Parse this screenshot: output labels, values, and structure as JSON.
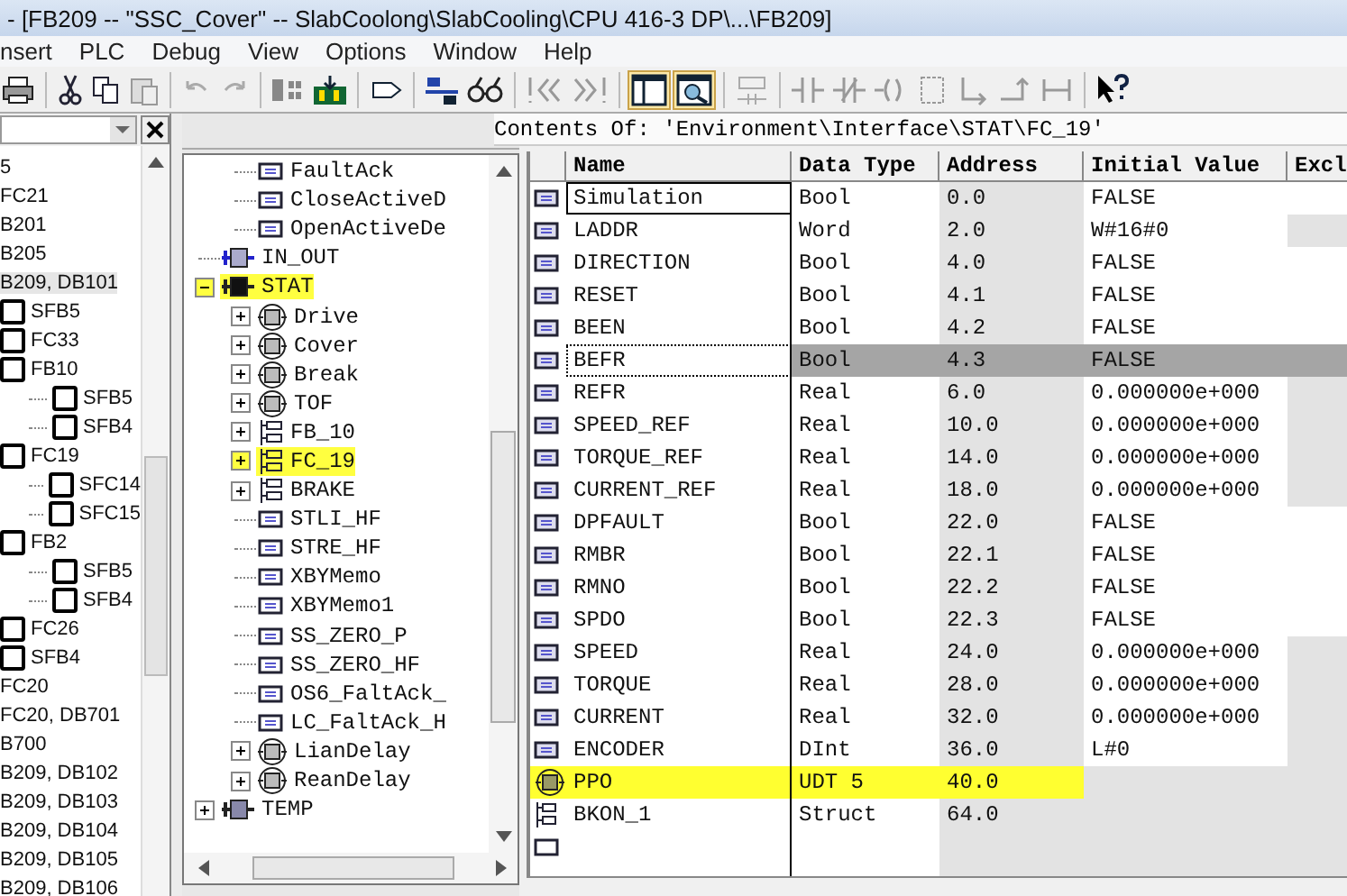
{
  "window": {
    "title": "- [FB209 -- \"SSC_Cover\" -- SlabCoolong\\SlabCooling\\CPU 416-3 DP\\...\\FB209]"
  },
  "menu": [
    "nsert",
    "PLC",
    "Debug",
    "View",
    "Options",
    "Window",
    "Help"
  ],
  "block_list": {
    "items": [
      {
        "label": "5"
      },
      {
        "label": "FC21"
      },
      {
        "label": "B201"
      },
      {
        "label": "B205"
      },
      {
        "label": "B209, DB101",
        "selected": true,
        "children": [
          {
            "label": "SFB5"
          },
          {
            "label": "FC33"
          },
          {
            "label": "FB10",
            "children": [
              {
                "label": "SFB5"
              },
              {
                "label": "SFB4"
              }
            ]
          },
          {
            "label": "FC19",
            "children": [
              {
                "label": "SFC14"
              },
              {
                "label": "SFC15"
              }
            ]
          },
          {
            "label": "FB2",
            "children": [
              {
                "label": "SFB5"
              },
              {
                "label": "SFB4"
              }
            ]
          },
          {
            "label": "FC26"
          },
          {
            "label": "SFB4"
          }
        ]
      },
      {
        "label": "FC20"
      },
      {
        "label": "FC20, DB701"
      },
      {
        "label": "B700"
      },
      {
        "label": "B209, DB102"
      },
      {
        "label": "B209, DB103"
      },
      {
        "label": "B209, DB104"
      },
      {
        "label": "B209, DB105"
      },
      {
        "label": "B209, DB106"
      }
    ]
  },
  "tree": {
    "continued_children": [
      {
        "label": "FaultAck",
        "kind": "param"
      },
      {
        "label": "CloseActiveD",
        "kind": "param"
      },
      {
        "label": "OpenActiveDe",
        "kind": "param"
      }
    ],
    "items": [
      {
        "label": "IN_OUT",
        "kind": "inout",
        "highlighted": false
      },
      {
        "label": "STAT",
        "kind": "stat",
        "expanded": true,
        "highlighted": true,
        "children": [
          {
            "label": "Drive",
            "kind": "instance",
            "expanded": false,
            "highlighted": false
          },
          {
            "label": "Cover",
            "kind": "instance",
            "expanded": false,
            "highlighted": false
          },
          {
            "label": "Break",
            "kind": "instance",
            "expanded": false,
            "highlighted": false
          },
          {
            "label": "TOF",
            "kind": "instance",
            "expanded": false,
            "highlighted": false
          },
          {
            "label": "FB_10",
            "kind": "struct",
            "expanded": false,
            "highlighted": false
          },
          {
            "label": "FC_19",
            "kind": "struct",
            "expanded": false,
            "highlighted": true
          },
          {
            "label": "BRAKE",
            "kind": "struct",
            "expanded": false,
            "highlighted": false
          },
          {
            "label": "STLI_HF",
            "kind": "param",
            "highlighted": false
          },
          {
            "label": "STRE_HF",
            "kind": "param",
            "highlighted": false
          },
          {
            "label": "XBYMemo",
            "kind": "param",
            "highlighted": false
          },
          {
            "label": "XBYMemo1",
            "kind": "param",
            "highlighted": false
          },
          {
            "label": "SS_ZERO_P",
            "kind": "param",
            "highlighted": false
          },
          {
            "label": "SS_ZERO_HF",
            "kind": "param",
            "highlighted": false
          },
          {
            "label": "OS6_FaltAck_",
            "kind": "param",
            "highlighted": false
          },
          {
            "label": "LC_FaltAck_H",
            "kind": "param",
            "highlighted": false
          },
          {
            "label": "LianDelay",
            "kind": "instance",
            "expanded": false,
            "highlighted": false
          },
          {
            "label": "ReanDelay",
            "kind": "instance",
            "expanded": false,
            "highlighted": false
          }
        ]
      },
      {
        "label": "TEMP",
        "kind": "temp",
        "expanded": false,
        "highlighted": false
      }
    ]
  },
  "contents": {
    "path": "Contents Of: 'Environment\\Interface\\STAT\\FC_19'",
    "columns": [
      "Name",
      "Data Type",
      "Address",
      "Initial Value",
      "Excl"
    ],
    "rows": [
      {
        "kind": "param",
        "name": "Simulation",
        "type": "Bool",
        "address": "0.0",
        "initial": "FALSE",
        "editing": true,
        "selected": false,
        "highlighted": false,
        "excl_enabled": true
      },
      {
        "kind": "param",
        "name": "LADDR",
        "type": "Word",
        "address": "2.0",
        "initial": "W#16#0",
        "editing": false,
        "selected": false,
        "highlighted": false,
        "excl_enabled": false
      },
      {
        "kind": "param",
        "name": "DIRECTION",
        "type": "Bool",
        "address": "4.0",
        "initial": "FALSE",
        "editing": false,
        "selected": false,
        "highlighted": false,
        "excl_enabled": true
      },
      {
        "kind": "param",
        "name": "RESET",
        "type": "Bool",
        "address": "4.1",
        "initial": "FALSE",
        "editing": false,
        "selected": false,
        "highlighted": false,
        "excl_enabled": true
      },
      {
        "kind": "param",
        "name": "BEEN",
        "type": "Bool",
        "address": "4.2",
        "initial": "FALSE",
        "editing": false,
        "selected": false,
        "highlighted": false,
        "excl_enabled": true
      },
      {
        "kind": "param",
        "name": "BEFR",
        "type": "Bool",
        "address": "4.3",
        "initial": "FALSE",
        "editing": false,
        "selected": true,
        "highlighted": false,
        "excl_enabled": true
      },
      {
        "kind": "param",
        "name": "REFR",
        "type": "Real",
        "address": "6.0",
        "initial": "0.000000e+000",
        "editing": false,
        "selected": false,
        "highlighted": false,
        "excl_enabled": false
      },
      {
        "kind": "param",
        "name": "SPEED_REF",
        "type": "Real",
        "address": "10.0",
        "initial": "0.000000e+000",
        "editing": false,
        "selected": false,
        "highlighted": false,
        "excl_enabled": false
      },
      {
        "kind": "param",
        "name": "TORQUE_REF",
        "type": "Real",
        "address": "14.0",
        "initial": "0.000000e+000",
        "editing": false,
        "selected": false,
        "highlighted": false,
        "excl_enabled": false
      },
      {
        "kind": "param",
        "name": "CURRENT_REF",
        "type": "Real",
        "address": "18.0",
        "initial": "0.000000e+000",
        "editing": false,
        "selected": false,
        "highlighted": false,
        "excl_enabled": false
      },
      {
        "kind": "param",
        "name": "DPFAULT",
        "type": "Bool",
        "address": "22.0",
        "initial": "FALSE",
        "editing": false,
        "selected": false,
        "highlighted": false,
        "excl_enabled": true
      },
      {
        "kind": "param",
        "name": "RMBR",
        "type": "Bool",
        "address": "22.1",
        "initial": "FALSE",
        "editing": false,
        "selected": false,
        "highlighted": false,
        "excl_enabled": true
      },
      {
        "kind": "param",
        "name": "RMNO",
        "type": "Bool",
        "address": "22.2",
        "initial": "FALSE",
        "editing": false,
        "selected": false,
        "highlighted": false,
        "excl_enabled": true
      },
      {
        "kind": "param",
        "name": "SPDO",
        "type": "Bool",
        "address": "22.3",
        "initial": "FALSE",
        "editing": false,
        "selected": false,
        "highlighted": false,
        "excl_enabled": true
      },
      {
        "kind": "param",
        "name": "SPEED",
        "type": "Real",
        "address": "24.0",
        "initial": "0.000000e+000",
        "editing": false,
        "selected": false,
        "highlighted": false,
        "excl_enabled": false
      },
      {
        "kind": "param",
        "name": "TORQUE",
        "type": "Real",
        "address": "28.0",
        "initial": "0.000000e+000",
        "editing": false,
        "selected": false,
        "highlighted": false,
        "excl_enabled": false
      },
      {
        "kind": "param",
        "name": "CURRENT",
        "type": "Real",
        "address": "32.0",
        "initial": "0.000000e+000",
        "editing": false,
        "selected": false,
        "highlighted": false,
        "excl_enabled": false
      },
      {
        "kind": "param",
        "name": "ENCODER",
        "type": "DInt",
        "address": "36.0",
        "initial": "L#0",
        "editing": false,
        "selected": false,
        "highlighted": false,
        "excl_enabled": false
      },
      {
        "kind": "instance",
        "name": "PPO",
        "type": "UDT 5",
        "address": "40.0",
        "editing": false,
        "selected": false,
        "highlighted": true
      },
      {
        "kind": "struct",
        "name": "BKON_1",
        "type": "Struct",
        "address": "64.0",
        "editing": false,
        "selected": false,
        "highlighted": false
      }
    ],
    "blank_row": true
  }
}
